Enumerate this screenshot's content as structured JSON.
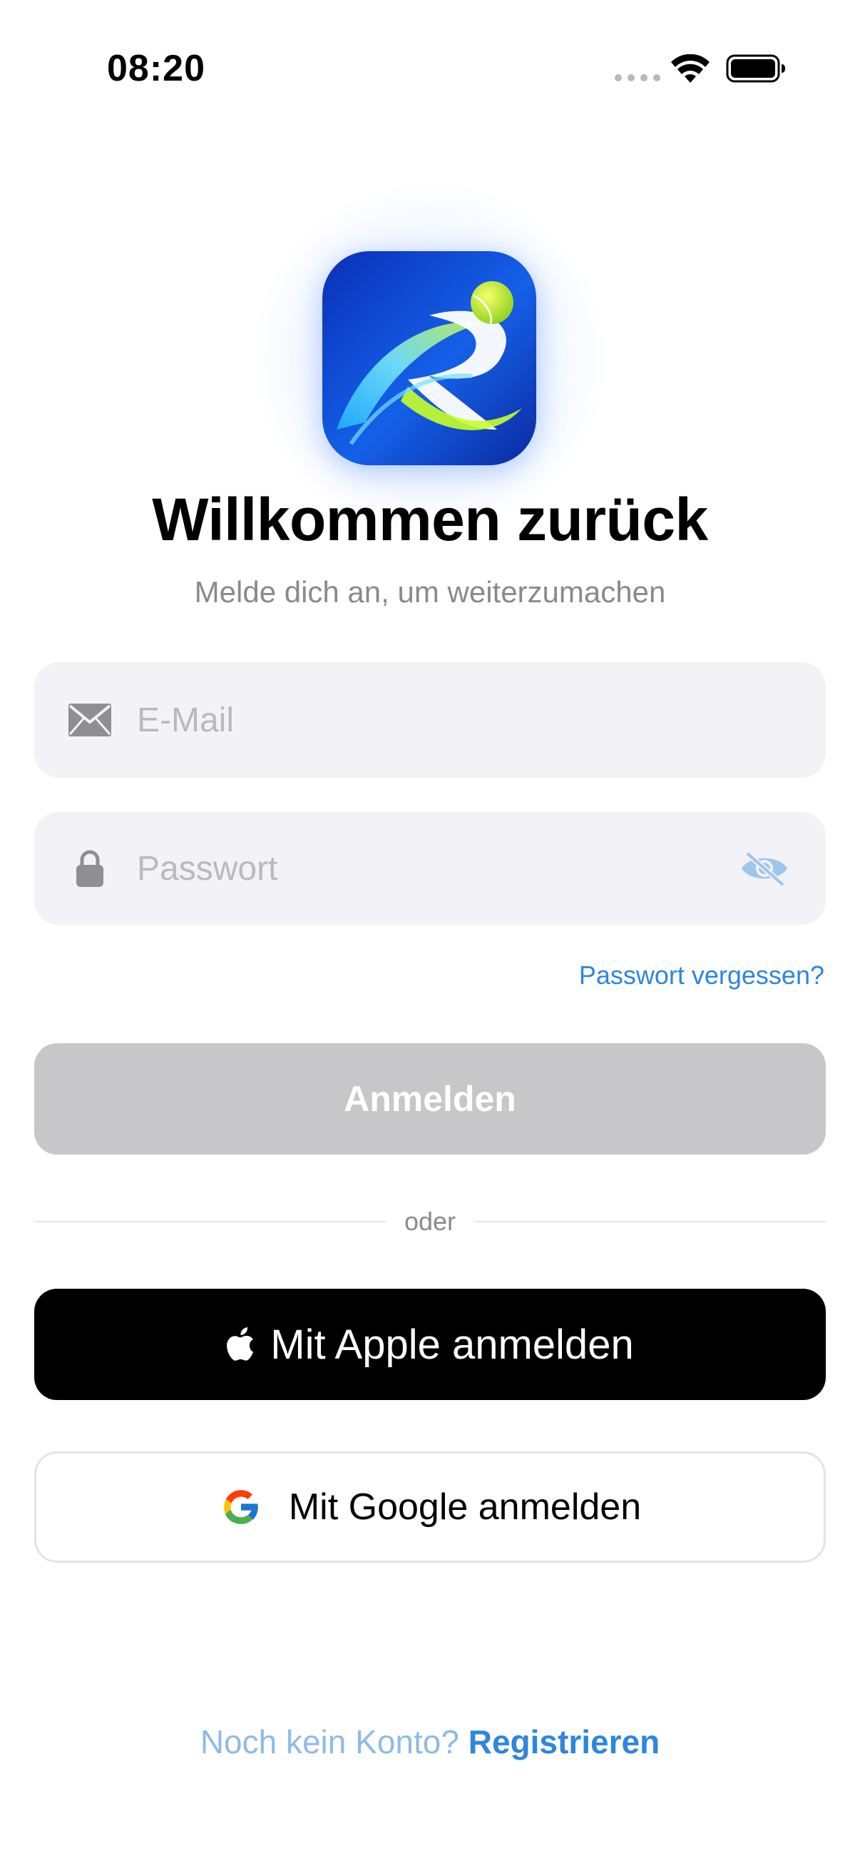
{
  "status_bar": {
    "time": "08:20"
  },
  "header": {
    "title": "Willkommen zurück",
    "subtitle": "Melde dich an, um weiterzumachen"
  },
  "form": {
    "email_placeholder": "E-Mail",
    "email_value": "",
    "password_placeholder": "Passwort",
    "password_value": "",
    "forgot_password": "Passwort vergessen?",
    "login_button": "Anmelden"
  },
  "divider_text": "oder",
  "social": {
    "apple_button": "Mit Apple anmelden",
    "google_button": "Mit Google anmelden"
  },
  "footer": {
    "prompt": "Noch kein Konto?",
    "register": "Registrieren"
  },
  "icons": {
    "email": "envelope-icon",
    "password": "lock-icon",
    "visibility": "eye-slash-icon",
    "apple": "apple-logo-icon",
    "google": "google-logo-icon"
  },
  "colors": {
    "accent": "#2e86de",
    "field_background": "#f2f2f7",
    "disabled_button": "#c7c7c9",
    "apple_button": "#000000"
  }
}
